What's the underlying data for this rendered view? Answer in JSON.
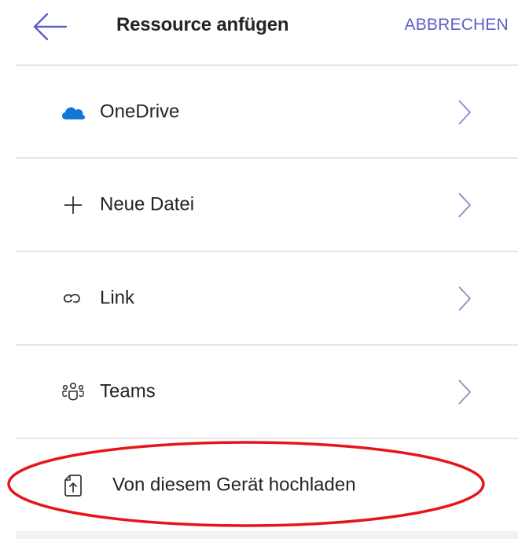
{
  "header": {
    "title": "Ressource anfügen",
    "cancel_label": "ABBRECHEN",
    "back_icon": "arrow-left-icon"
  },
  "items": [
    {
      "label": "OneDrive",
      "icon": "onedrive-cloud-icon",
      "has_chevron": true
    },
    {
      "label": "Neue Datei",
      "icon": "plus-icon",
      "has_chevron": true
    },
    {
      "label": "Link",
      "icon": "link-icon",
      "has_chevron": true
    },
    {
      "label": "Teams",
      "icon": "teams-people-icon",
      "has_chevron": true
    },
    {
      "label": "Von diesem Gerät hochladen",
      "icon": "upload-file-icon",
      "has_chevron": false
    }
  ],
  "colors": {
    "accent": "#5b5fc7",
    "onedrive": "#0f78d4",
    "highlight": "#e8141b",
    "divider": "#e6e6e6"
  }
}
